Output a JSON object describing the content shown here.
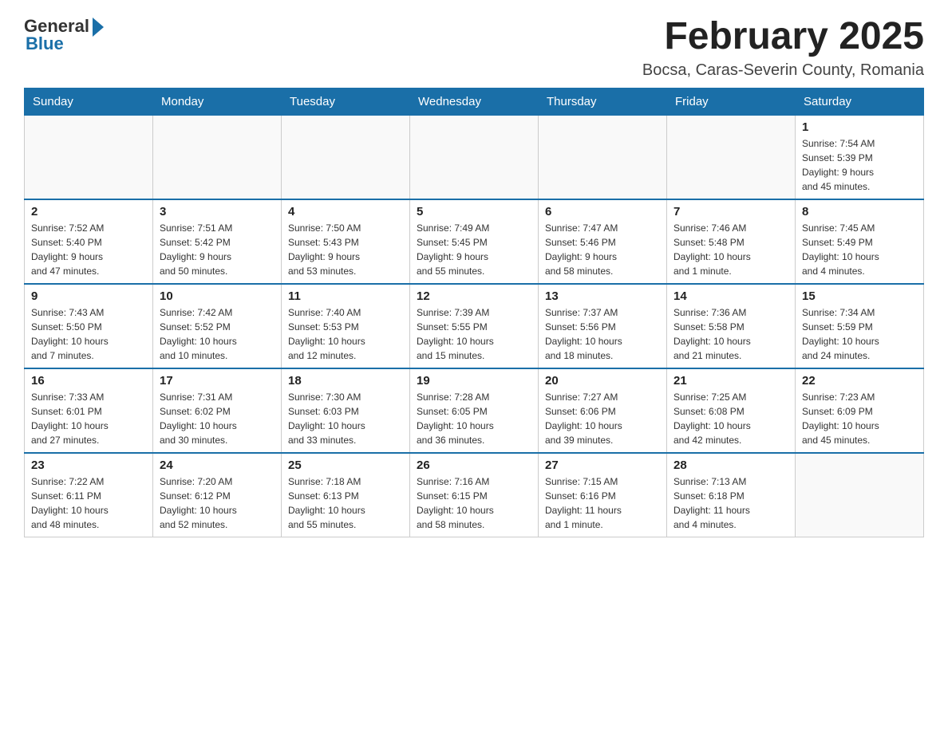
{
  "logo": {
    "general": "General",
    "blue": "Blue"
  },
  "title": "February 2025",
  "location": "Bocsa, Caras-Severin County, Romania",
  "days_header": [
    "Sunday",
    "Monday",
    "Tuesday",
    "Wednesday",
    "Thursday",
    "Friday",
    "Saturday"
  ],
  "weeks": [
    [
      {
        "day": "",
        "info": ""
      },
      {
        "day": "",
        "info": ""
      },
      {
        "day": "",
        "info": ""
      },
      {
        "day": "",
        "info": ""
      },
      {
        "day": "",
        "info": ""
      },
      {
        "day": "",
        "info": ""
      },
      {
        "day": "1",
        "info": "Sunrise: 7:54 AM\nSunset: 5:39 PM\nDaylight: 9 hours\nand 45 minutes."
      }
    ],
    [
      {
        "day": "2",
        "info": "Sunrise: 7:52 AM\nSunset: 5:40 PM\nDaylight: 9 hours\nand 47 minutes."
      },
      {
        "day": "3",
        "info": "Sunrise: 7:51 AM\nSunset: 5:42 PM\nDaylight: 9 hours\nand 50 minutes."
      },
      {
        "day": "4",
        "info": "Sunrise: 7:50 AM\nSunset: 5:43 PM\nDaylight: 9 hours\nand 53 minutes."
      },
      {
        "day": "5",
        "info": "Sunrise: 7:49 AM\nSunset: 5:45 PM\nDaylight: 9 hours\nand 55 minutes."
      },
      {
        "day": "6",
        "info": "Sunrise: 7:47 AM\nSunset: 5:46 PM\nDaylight: 9 hours\nand 58 minutes."
      },
      {
        "day": "7",
        "info": "Sunrise: 7:46 AM\nSunset: 5:48 PM\nDaylight: 10 hours\nand 1 minute."
      },
      {
        "day": "8",
        "info": "Sunrise: 7:45 AM\nSunset: 5:49 PM\nDaylight: 10 hours\nand 4 minutes."
      }
    ],
    [
      {
        "day": "9",
        "info": "Sunrise: 7:43 AM\nSunset: 5:50 PM\nDaylight: 10 hours\nand 7 minutes."
      },
      {
        "day": "10",
        "info": "Sunrise: 7:42 AM\nSunset: 5:52 PM\nDaylight: 10 hours\nand 10 minutes."
      },
      {
        "day": "11",
        "info": "Sunrise: 7:40 AM\nSunset: 5:53 PM\nDaylight: 10 hours\nand 12 minutes."
      },
      {
        "day": "12",
        "info": "Sunrise: 7:39 AM\nSunset: 5:55 PM\nDaylight: 10 hours\nand 15 minutes."
      },
      {
        "day": "13",
        "info": "Sunrise: 7:37 AM\nSunset: 5:56 PM\nDaylight: 10 hours\nand 18 minutes."
      },
      {
        "day": "14",
        "info": "Sunrise: 7:36 AM\nSunset: 5:58 PM\nDaylight: 10 hours\nand 21 minutes."
      },
      {
        "day": "15",
        "info": "Sunrise: 7:34 AM\nSunset: 5:59 PM\nDaylight: 10 hours\nand 24 minutes."
      }
    ],
    [
      {
        "day": "16",
        "info": "Sunrise: 7:33 AM\nSunset: 6:01 PM\nDaylight: 10 hours\nand 27 minutes."
      },
      {
        "day": "17",
        "info": "Sunrise: 7:31 AM\nSunset: 6:02 PM\nDaylight: 10 hours\nand 30 minutes."
      },
      {
        "day": "18",
        "info": "Sunrise: 7:30 AM\nSunset: 6:03 PM\nDaylight: 10 hours\nand 33 minutes."
      },
      {
        "day": "19",
        "info": "Sunrise: 7:28 AM\nSunset: 6:05 PM\nDaylight: 10 hours\nand 36 minutes."
      },
      {
        "day": "20",
        "info": "Sunrise: 7:27 AM\nSunset: 6:06 PM\nDaylight: 10 hours\nand 39 minutes."
      },
      {
        "day": "21",
        "info": "Sunrise: 7:25 AM\nSunset: 6:08 PM\nDaylight: 10 hours\nand 42 minutes."
      },
      {
        "day": "22",
        "info": "Sunrise: 7:23 AM\nSunset: 6:09 PM\nDaylight: 10 hours\nand 45 minutes."
      }
    ],
    [
      {
        "day": "23",
        "info": "Sunrise: 7:22 AM\nSunset: 6:11 PM\nDaylight: 10 hours\nand 48 minutes."
      },
      {
        "day": "24",
        "info": "Sunrise: 7:20 AM\nSunset: 6:12 PM\nDaylight: 10 hours\nand 52 minutes."
      },
      {
        "day": "25",
        "info": "Sunrise: 7:18 AM\nSunset: 6:13 PM\nDaylight: 10 hours\nand 55 minutes."
      },
      {
        "day": "26",
        "info": "Sunrise: 7:16 AM\nSunset: 6:15 PM\nDaylight: 10 hours\nand 58 minutes."
      },
      {
        "day": "27",
        "info": "Sunrise: 7:15 AM\nSunset: 6:16 PM\nDaylight: 11 hours\nand 1 minute."
      },
      {
        "day": "28",
        "info": "Sunrise: 7:13 AM\nSunset: 6:18 PM\nDaylight: 11 hours\nand 4 minutes."
      },
      {
        "day": "",
        "info": ""
      }
    ]
  ]
}
